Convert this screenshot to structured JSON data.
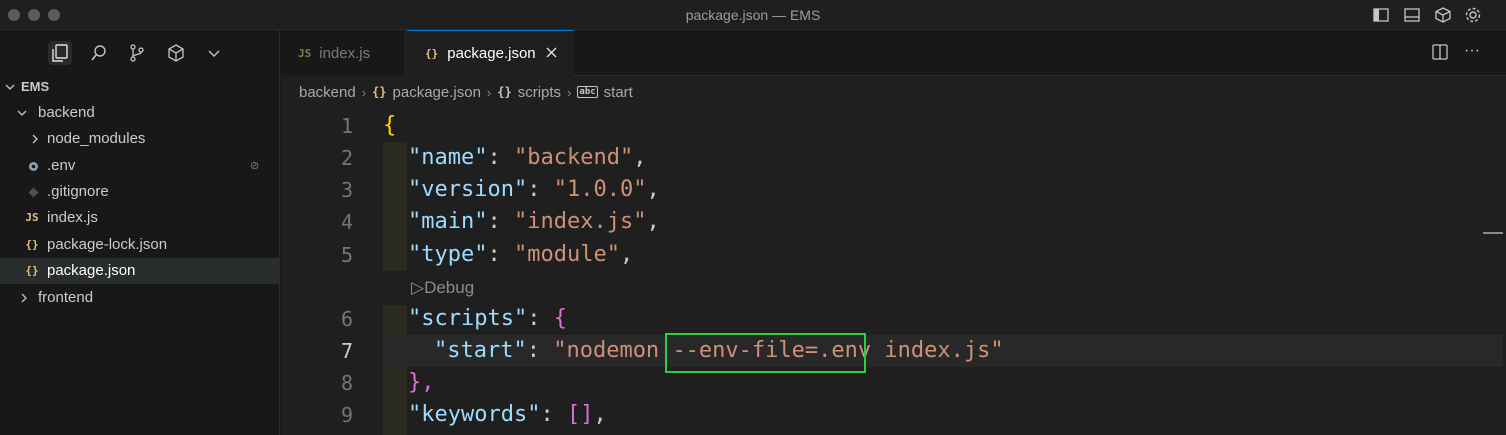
{
  "window": {
    "title": "package.json — EMS"
  },
  "explorer": {
    "root_label": "EMS",
    "items": [
      {
        "label": "backend",
        "kind": "folder-open",
        "icon": ""
      },
      {
        "label": "node_modules",
        "kind": "folder",
        "icon": ""
      },
      {
        "label": ".env",
        "kind": "file",
        "icon": "gear-icon"
      },
      {
        "label": ".gitignore",
        "kind": "file",
        "icon": "git-icon"
      },
      {
        "label": "index.js",
        "kind": "file",
        "icon": "JS"
      },
      {
        "label": "package-lock.json",
        "kind": "file",
        "icon": "{}"
      },
      {
        "label": "package.json",
        "kind": "file",
        "icon": "{}"
      },
      {
        "label": "frontend",
        "kind": "folder",
        "icon": ""
      }
    ]
  },
  "tabs": [
    {
      "label": "index.js",
      "icon": "JS"
    },
    {
      "label": "package.json",
      "icon": "{}"
    }
  ],
  "breadcrumb": {
    "items": [
      "backend",
      "package.json",
      "scripts",
      "start"
    ]
  },
  "editor": {
    "codelens": "Debug",
    "lines": [
      {
        "num": "1",
        "text": "{"
      },
      {
        "num": "2",
        "key": "\"name\"",
        "value": "\"backend\"",
        "end": ","
      },
      {
        "num": "3",
        "key": "\"version\"",
        "value": "\"1.0.0\"",
        "end": ","
      },
      {
        "num": "4",
        "key": "\"main\"",
        "value": "\"index.js\"",
        "end": ","
      },
      {
        "num": "5",
        "key": "\"type\"",
        "value": "\"module\"",
        "end": ","
      },
      {
        "num": "6",
        "key": "\"scripts\"",
        "value": "{",
        "end": ""
      },
      {
        "num": "7",
        "key": "\"start\"",
        "value_a": "\"nodemon ",
        "value_b": "--env-file=.env",
        "value_c": " index.js\"",
        "end": ""
      },
      {
        "num": "8",
        "text": "},"
      },
      {
        "num": "9",
        "key": "\"keywords\"",
        "value": "[]",
        "end": ","
      }
    ]
  },
  "colors": {
    "highlight_box": "#2ecc40",
    "accent": "#0078d4"
  }
}
